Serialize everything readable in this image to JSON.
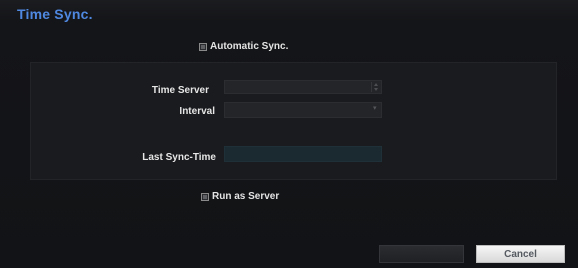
{
  "dialog": {
    "title": "Time Sync."
  },
  "automatic_sync": {
    "label": "Automatic Sync.",
    "checked": false
  },
  "fields": {
    "time_server_label": "Time Server",
    "time_server_value": "",
    "interval_label": "Interval",
    "interval_value": "",
    "last_sync_label": "Last Sync-Time",
    "last_sync_value": ""
  },
  "run_as_server": {
    "label": "Run as Server",
    "checked": false
  },
  "buttons": {
    "ok_label": "",
    "cancel_label": "Cancel"
  },
  "colors": {
    "title": "#4f88e0",
    "background": "#121316",
    "panel": "#1a1b1e",
    "cancel_button": "#eeeeee"
  }
}
